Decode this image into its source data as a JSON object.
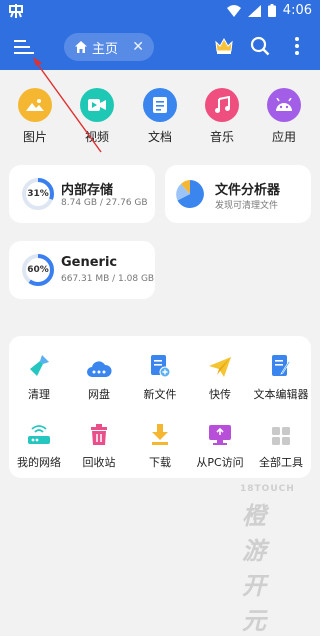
{
  "status": {
    "time": "4:06"
  },
  "toolbar": {
    "tab_label": "主页"
  },
  "categories": [
    {
      "label": "图片",
      "color": "#f5b731",
      "icon": "image-icon"
    },
    {
      "label": "视频",
      "color": "#1fc8b4",
      "icon": "video-icon"
    },
    {
      "label": "文档",
      "color": "#3a86ee",
      "icon": "document-icon"
    },
    {
      "label": "音乐",
      "color": "#ef4f7e",
      "icon": "music-icon"
    },
    {
      "label": "应用",
      "color": "#a35ee8",
      "icon": "android-icon"
    }
  ],
  "storage": [
    {
      "title": "内部存储",
      "detail": "8.74 GB / 27.76 GB",
      "percent_label": "31%",
      "fraction": 0.31
    },
    {
      "title": "Generic",
      "detail": "667.31 MB / 1.08 GB",
      "percent_label": "60%",
      "fraction": 0.6
    }
  ],
  "analyzer": {
    "title": "文件分析器",
    "subtitle": "发现可清理文件"
  },
  "tools": [
    {
      "label": "清理",
      "icon": "broom-icon"
    },
    {
      "label": "网盘",
      "icon": "cloud-icon"
    },
    {
      "label": "新文件",
      "icon": "new-file-icon"
    },
    {
      "label": "快传",
      "icon": "send-icon"
    },
    {
      "label": "文本编辑器",
      "icon": "text-editor-icon"
    },
    {
      "label": "我的网络",
      "icon": "router-icon"
    },
    {
      "label": "回收站",
      "icon": "trash-icon"
    },
    {
      "label": "下载",
      "icon": "download-icon"
    },
    {
      "label": "从PC访问",
      "icon": "pc-access-icon"
    },
    {
      "label": "全部工具",
      "icon": "all-tools-icon"
    }
  ],
  "watermark": {
    "line1": "18TOUCH",
    "line2": "橙游开元"
  },
  "colors": {
    "primary": "#2f6fe0",
    "ring": "#3a7ff0",
    "ring_track": "#dfe6f3"
  }
}
